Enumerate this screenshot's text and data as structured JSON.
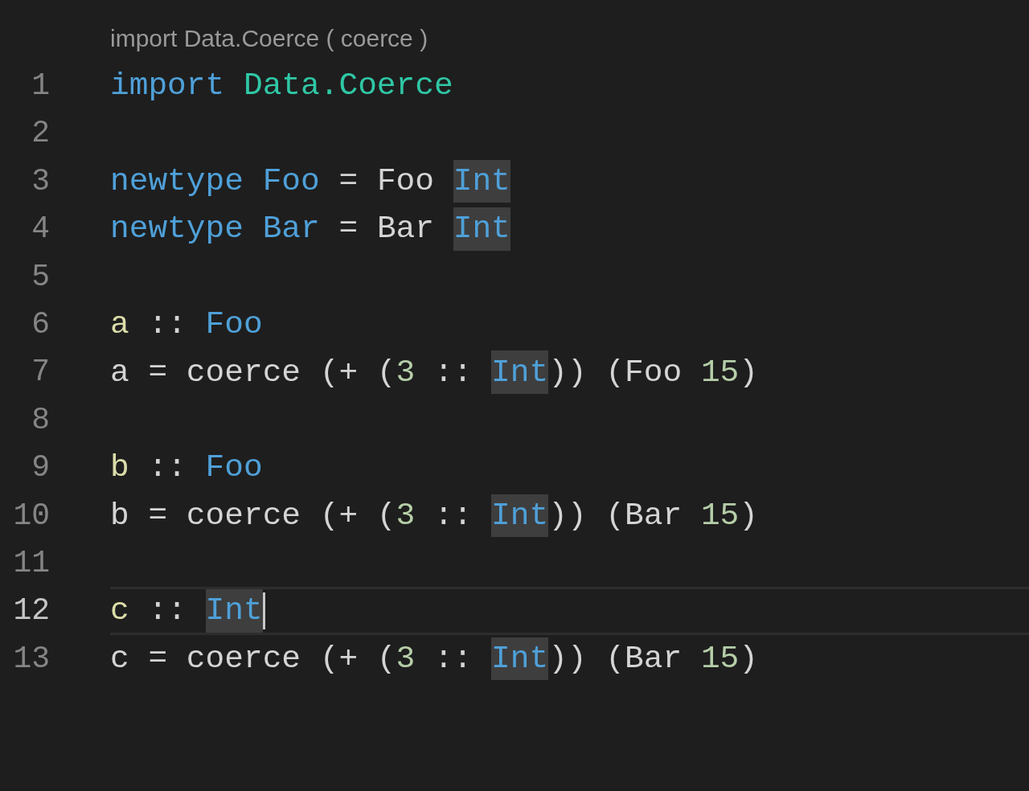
{
  "codelens": "import Data.Coerce ( coerce )",
  "lines": [
    {
      "number": "1",
      "current": false,
      "cursor": false,
      "tokens": [
        {
          "text": "import ",
          "kind": "keyword",
          "highlighted": false
        },
        {
          "text": "Data.Coerce",
          "kind": "module",
          "highlighted": false
        }
      ]
    },
    {
      "number": "2",
      "current": false,
      "cursor": false
    },
    {
      "number": "3",
      "current": false,
      "cursor": false,
      "tokens": [
        {
          "text": "newtype ",
          "kind": "keyword",
          "highlighted": false
        },
        {
          "text": "Foo",
          "kind": "type",
          "highlighted": false
        },
        {
          "text": " = Foo ",
          "kind": "plain",
          "highlighted": false
        },
        {
          "text": "Int",
          "kind": "type",
          "highlighted": true
        }
      ]
    },
    {
      "number": "4",
      "current": false,
      "cursor": false,
      "tokens": [
        {
          "text": "newtype ",
          "kind": "keyword",
          "highlighted": false
        },
        {
          "text": "Bar",
          "kind": "type",
          "highlighted": false
        },
        {
          "text": " = Bar ",
          "kind": "plain",
          "highlighted": false
        },
        {
          "text": "Int",
          "kind": "type",
          "highlighted": true
        }
      ]
    },
    {
      "number": "5",
      "current": false,
      "cursor": false
    },
    {
      "number": "6",
      "current": false,
      "cursor": false,
      "tokens": [
        {
          "text": "a",
          "kind": "function",
          "highlighted": false
        },
        {
          "text": " :: ",
          "kind": "plain",
          "highlighted": false
        },
        {
          "text": "Foo",
          "kind": "type",
          "highlighted": false
        }
      ]
    },
    {
      "number": "7",
      "current": false,
      "cursor": false,
      "tokens": [
        {
          "text": "a = coerce (+ (",
          "kind": "plain",
          "highlighted": false
        },
        {
          "text": "3",
          "kind": "number",
          "highlighted": false
        },
        {
          "text": " :: ",
          "kind": "plain",
          "highlighted": false
        },
        {
          "text": "Int",
          "kind": "type",
          "highlighted": true
        },
        {
          "text": ")) (Foo ",
          "kind": "plain",
          "highlighted": false
        },
        {
          "text": "15",
          "kind": "number",
          "highlighted": false
        },
        {
          "text": ")",
          "kind": "plain",
          "highlighted": false
        }
      ]
    },
    {
      "number": "8",
      "current": false,
      "cursor": false
    },
    {
      "number": "9",
      "current": false,
      "cursor": false,
      "tokens": [
        {
          "text": "b",
          "kind": "function",
          "highlighted": false
        },
        {
          "text": " :: ",
          "kind": "plain",
          "highlighted": false
        },
        {
          "text": "Foo",
          "kind": "type",
          "highlighted": false
        }
      ]
    },
    {
      "number": "10",
      "current": false,
      "cursor": false,
      "tokens": [
        {
          "text": "b = coerce (+ (",
          "kind": "plain",
          "highlighted": false
        },
        {
          "text": "3",
          "kind": "number",
          "highlighted": false
        },
        {
          "text": " :: ",
          "kind": "plain",
          "highlighted": false
        },
        {
          "text": "Int",
          "kind": "type",
          "highlighted": true
        },
        {
          "text": ")) (Bar ",
          "kind": "plain",
          "highlighted": false
        },
        {
          "text": "15",
          "kind": "number",
          "highlighted": false
        },
        {
          "text": ")",
          "kind": "plain",
          "highlighted": false
        }
      ]
    },
    {
      "number": "11",
      "current": false,
      "cursor": false
    },
    {
      "number": "12",
      "current": true,
      "cursor": true,
      "tokens": [
        {
          "text": "c",
          "kind": "function",
          "highlighted": false
        },
        {
          "text": " :: ",
          "kind": "plain",
          "highlighted": false
        },
        {
          "text": "Int",
          "kind": "type",
          "highlighted": true
        }
      ]
    },
    {
      "number": "13",
      "current": false,
      "cursor": false,
      "tokens": [
        {
          "text": "c = coerce (+ (",
          "kind": "plain",
          "highlighted": false
        },
        {
          "text": "3",
          "kind": "number",
          "highlighted": false
        },
        {
          "text": " :: ",
          "kind": "plain",
          "highlighted": false
        },
        {
          "text": "Int",
          "kind": "type",
          "highlighted": true
        },
        {
          "text": ")) (Bar ",
          "kind": "plain",
          "highlighted": false
        },
        {
          "text": "15",
          "kind": "number",
          "highlighted": false
        },
        {
          "text": ")",
          "kind": "plain",
          "highlighted": false
        }
      ]
    }
  ]
}
